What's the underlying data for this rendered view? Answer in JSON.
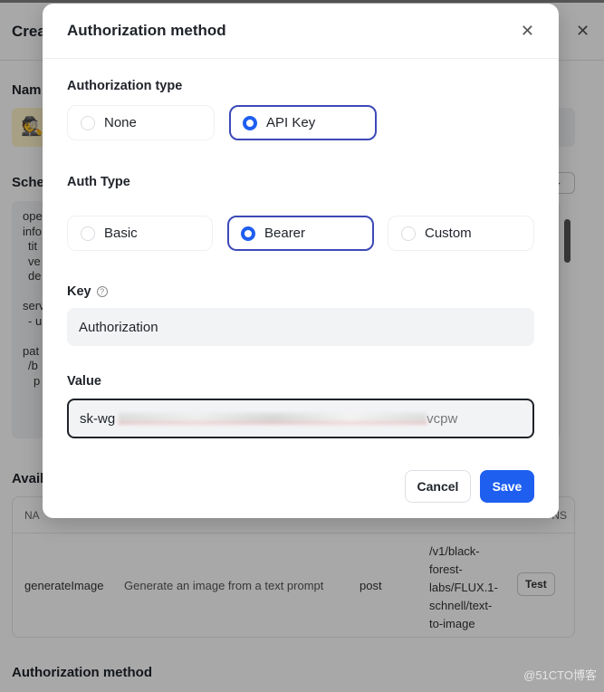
{
  "background": {
    "header_title": "Crea",
    "name_label": "Nam",
    "schema_label": "Sche",
    "schema_lines": [
      "ope",
      "info",
      "tit",
      "ve",
      "de",
      "",
      "serv",
      "- u",
      "",
      "pat",
      "/b",
      "p"
    ],
    "available_label": "Avail",
    "table": {
      "header_left": "NA",
      "header_right": "NS",
      "row": {
        "name": "generateImage",
        "description": "Generate an image from a text prompt",
        "method": "post",
        "path": "/v1/black-forest-labs/FLUX.1-schnell/text-to-image",
        "action": "Test"
      }
    },
    "auth_section_label": "Authorization method",
    "watermark": "@51CTO博客"
  },
  "modal": {
    "title": "Authorization method",
    "authorization_type": {
      "label": "Authorization type",
      "options": [
        "None",
        "API Key"
      ],
      "selected": "API Key"
    },
    "auth_type": {
      "label": "Auth Type",
      "options": [
        "Basic",
        "Bearer",
        "Custom"
      ],
      "selected": "Bearer"
    },
    "key": {
      "label": "Key",
      "value": "Authorization"
    },
    "value": {
      "label": "Value",
      "value": "sk-wg",
      "tail": "vcpw"
    },
    "cancel_label": "Cancel",
    "save_label": "Save",
    "colors": {
      "primary": "#1e5ff0",
      "selected_border": "#3d49b8"
    }
  }
}
